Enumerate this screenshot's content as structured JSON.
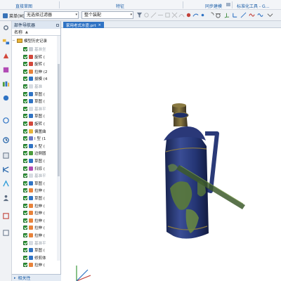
{
  "ribbon": {
    "groups": [
      "直接草图",
      "特征",
      "同步建模",
      "标准化工具 - G..."
    ]
  },
  "toolbar": {
    "menu_label": "菜单(M)",
    "selection_filter": "无选择过滤器",
    "assembly_scope": "整个装配"
  },
  "navigator": {
    "title": "部件导航器",
    "column_name": "名称",
    "root_label": "模型历史记录",
    "items": [
      {
        "label": "基准坐",
        "icon": "datum-csys-icon",
        "dim": true
      },
      {
        "label": "旋转 (",
        "icon": "revolve-icon",
        "dim": false
      },
      {
        "label": "旋转 (",
        "icon": "revolve-icon",
        "dim": false
      },
      {
        "label": "拉伸 (2",
        "icon": "extrude-icon",
        "dim": false
      },
      {
        "label": "拔模 (4",
        "icon": "draft-icon",
        "dim": false
      },
      {
        "label": "基准",
        "icon": "datum-plane-icon",
        "dim": true
      },
      {
        "label": "草图 (",
        "icon": "sketch-icon",
        "dim": false
      },
      {
        "label": "草图 (",
        "icon": "sketch-icon",
        "dim": false
      },
      {
        "label": "基准平",
        "icon": "datum-plane-icon",
        "dim": true
      },
      {
        "label": "草图 (",
        "icon": "sketch-icon",
        "dim": false
      },
      {
        "label": "旋转 (",
        "icon": "revolve-icon",
        "dim": false
      },
      {
        "label": "偏置曲",
        "icon": "offset-curve-icon",
        "dim": false
      },
      {
        "label": "I 型 (1",
        "icon": "i-form-icon",
        "dim": false
      },
      {
        "label": "X 型 (",
        "icon": "x-form-icon",
        "dim": false
      },
      {
        "label": "边倒圆",
        "icon": "edge-blend-icon",
        "dim": false
      },
      {
        "label": "草图 (",
        "icon": "sketch-icon",
        "dim": false
      },
      {
        "label": "扫掠 (",
        "icon": "sweep-icon",
        "dim": false
      },
      {
        "label": "基准平",
        "icon": "datum-plane-icon",
        "dim": true
      },
      {
        "label": "草图 (",
        "icon": "sketch-icon",
        "dim": false
      },
      {
        "label": "拉伸 (",
        "icon": "extrude-icon",
        "dim": false
      },
      {
        "label": "草图 (",
        "icon": "sketch-icon",
        "dim": false
      },
      {
        "label": "拉伸 (",
        "icon": "extrude-icon",
        "dim": false
      },
      {
        "label": "拉伸 (",
        "icon": "extrude-icon",
        "dim": false
      },
      {
        "label": "拉伸 (",
        "icon": "extrude-icon",
        "dim": false
      },
      {
        "label": "拉伸 (",
        "icon": "extrude-icon",
        "dim": false
      },
      {
        "label": "拉伸 (",
        "icon": "extrude-icon",
        "dim": false
      },
      {
        "label": "基准平",
        "icon": "datum-plane-icon",
        "dim": true
      },
      {
        "label": "草图 (",
        "icon": "sketch-icon",
        "dim": false
      },
      {
        "label": "修剪体",
        "icon": "trim-body-icon",
        "dim": false
      },
      {
        "label": "拉伸 (",
        "icon": "extrude-icon",
        "dim": false
      }
    ],
    "bottom_label": "相关性"
  },
  "graphics": {
    "tab_label": "家用老式水壶.prt",
    "close_symbol": "×"
  },
  "colors": {
    "body": "#1f2f66",
    "body_highlight": "#3a4d95",
    "trim": "#8a7a42",
    "land": "#5a7a3a",
    "handle": "#2a3a78",
    "accent": "#2f73c4"
  }
}
